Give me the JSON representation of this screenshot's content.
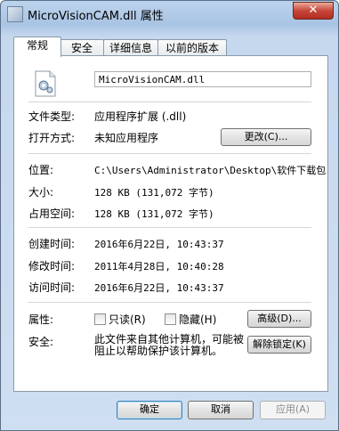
{
  "window": {
    "title": "MicroVisionCAM.dll 属性",
    "close": "✕"
  },
  "tabs": [
    {
      "label": "常规",
      "active": true
    },
    {
      "label": "安全"
    },
    {
      "label": "详细信息"
    },
    {
      "label": "以前的版本"
    }
  ],
  "general": {
    "filename": "MicroVisionCAM.dll",
    "file_type_label": "文件类型:",
    "file_type_value": "应用程序扩展 (.dll)",
    "open_with_label": "打开方式:",
    "open_with_value": "未知应用程序",
    "change_button": "更改(C)...",
    "location_label": "位置:",
    "location_value": "C:\\Users\\Administrator\\Desktop\\软件下载包",
    "size_label": "大小:",
    "size_value": "128 KB (131,072 字节)",
    "size_on_disk_label": "占用空间:",
    "size_on_disk_value": "128 KB (131,072 字节)",
    "created_label": "创建时间:",
    "created_value": "2016年6月22日, 10:43:37",
    "modified_label": "修改时间:",
    "modified_value": "2011年4月28日, 10:40:28",
    "accessed_label": "访问时间:",
    "accessed_value": "2016年6月22日, 10:43:37",
    "attributes_label": "属性:",
    "readonly_label": "只读(R)",
    "hidden_label": "隐藏(H)",
    "advanced_button": "高级(D)...",
    "security_label": "安全:",
    "security_text": "此文件来自其他计算机，可能被阻止以帮助保护该计算机。",
    "unblock_button": "解除锁定(K)"
  },
  "footer": {
    "ok": "确定",
    "cancel": "取消",
    "apply": "应用(A)"
  }
}
